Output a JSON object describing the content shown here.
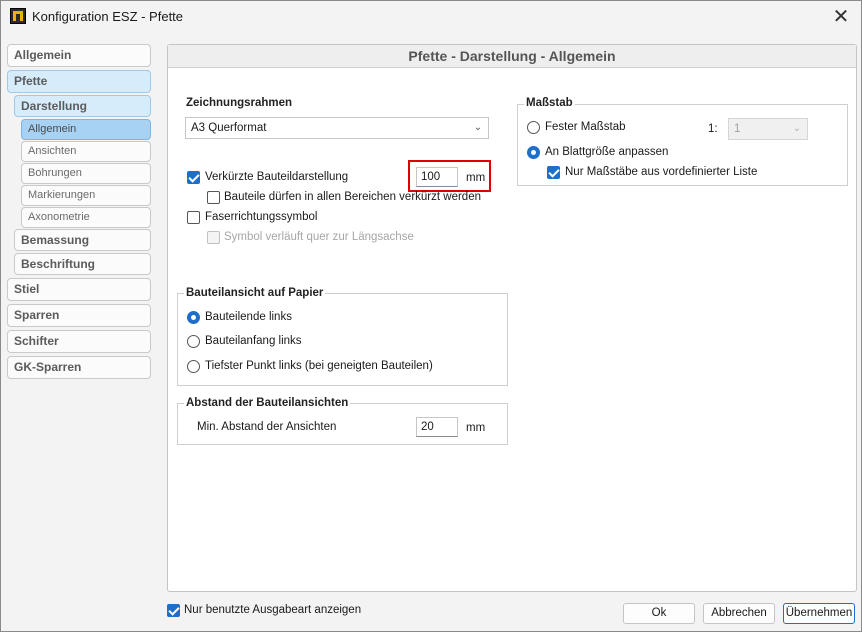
{
  "window": {
    "title": "Konfiguration ESZ - Pfette",
    "close_label": "✕"
  },
  "sidebar": {
    "items": [
      {
        "label": "Allgemein"
      },
      {
        "label": "Pfette"
      },
      {
        "label": "Darstellung"
      },
      {
        "label": "Allgemein"
      },
      {
        "label": "Ansichten"
      },
      {
        "label": "Bohrungen"
      },
      {
        "label": "Markierungen"
      },
      {
        "label": "Axonometrie"
      },
      {
        "label": "Bemassung"
      },
      {
        "label": "Beschriftung"
      },
      {
        "label": "Stiel"
      },
      {
        "label": "Sparren"
      },
      {
        "label": "Schifter"
      },
      {
        "label": "GK-Sparren"
      }
    ]
  },
  "panel": {
    "title": "Pfette - Darstellung -  Allgemein"
  },
  "zeichnungsrahmen": {
    "title": "Zeichnungsrahmen",
    "selected": "A3 Querformat"
  },
  "options": {
    "verkuerzt_label": "Verkürzte Bauteildarstellung",
    "verkuerzt_value": "100",
    "verkuerzt_unit": "mm",
    "alle_bereiche_label": "Bauteile dürfen in allen Bereichen verkürzt werden",
    "faser_label": "Faserrichtungssymbol",
    "quer_label": "Symbol verläuft quer zur Längsachse"
  },
  "massstab": {
    "title": "Maßstab",
    "fester_label": "Fester Maßstab",
    "ratio_prefix": "1:",
    "ratio_value": "1",
    "blatt_label": "An Blattgröße anpassen",
    "liste_label": "Nur Maßstäbe aus vordefinierter Liste"
  },
  "bauteilansicht": {
    "title": "Bauteilansicht auf Papier",
    "options": [
      {
        "label": "Bauteilende links"
      },
      {
        "label": "Bauteilanfang links"
      },
      {
        "label": "Tiefster Punkt links (bei geneigten Bauteilen)"
      }
    ]
  },
  "abstand": {
    "title": "Abstand der Bauteilansichten",
    "label": "Min. Abstand der Ansichten",
    "value": "20",
    "unit": "mm"
  },
  "footer": {
    "only_used_label": "Nur benutzte Ausgabeart anzeigen",
    "ok_label": "Ok",
    "cancel_label": "Abbrechen",
    "apply_label": "Übernehmen"
  },
  "colors": {
    "accent": "#1e6fc9",
    "highlight": "#e00000",
    "nav_active": "#d6ecfb",
    "nav_subactive": "#a7d2f3"
  },
  "icons": {
    "app": "app-logo-icon",
    "close": "close-icon",
    "dropdown": "chevron-down-icon"
  }
}
